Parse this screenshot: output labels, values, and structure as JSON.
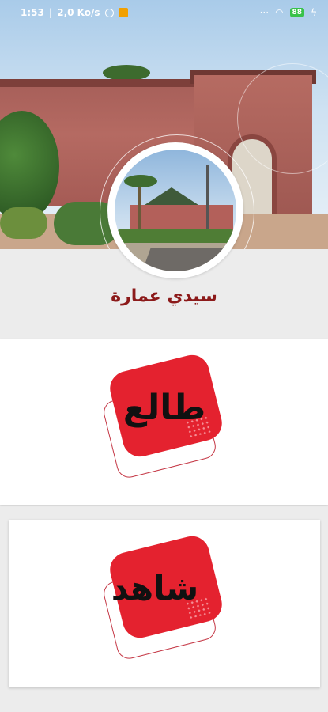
{
  "status_bar": {
    "time": "1:53",
    "network_speed": "2,0 Ko/s",
    "battery": "88"
  },
  "place": {
    "title": "سيدي عمارة"
  },
  "cards": [
    {
      "label": "طالع"
    },
    {
      "label": "شاهد"
    }
  ],
  "colors": {
    "title": "#8c1a1a",
    "logo_red": "#e4222f",
    "background": "#ececec"
  }
}
